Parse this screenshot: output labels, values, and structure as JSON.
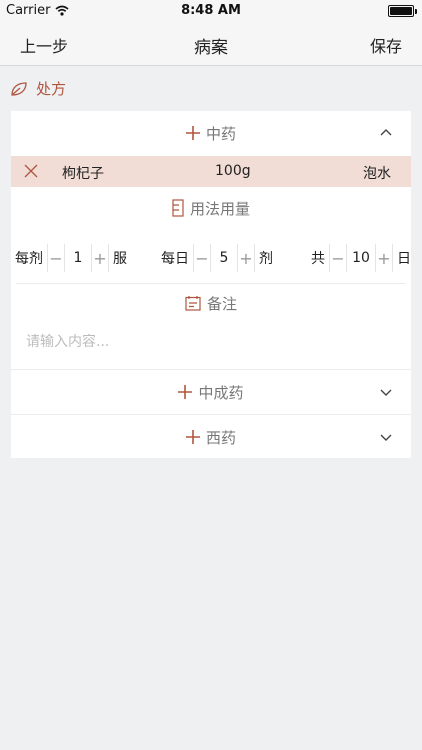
{
  "status_bar": {
    "carrier": "Carrier",
    "time": "8:48 AM"
  },
  "nav": {
    "back": "上一步",
    "title": "病案",
    "save": "保存"
  },
  "section": {
    "label": "处方"
  },
  "chinese_herbs": {
    "label": "中药",
    "items": [
      {
        "name": "枸杞子",
        "dose": "100g",
        "method": "泡水"
      }
    ]
  },
  "usage": {
    "label": "用法用量",
    "per_dose": {
      "label": "每剂",
      "value": "1",
      "unit": "服"
    },
    "per_day": {
      "label": "每日",
      "value": "5",
      "unit": "剂"
    },
    "total": {
      "label": "共",
      "value": "10",
      "unit": "日"
    }
  },
  "note": {
    "label": "备注",
    "placeholder": "请输入内容..."
  },
  "patent_medicine": {
    "label": "中成药"
  },
  "western_medicine": {
    "label": "西药"
  },
  "colors": {
    "accent": "#b0553f",
    "highlight_row": "#f1ddd6",
    "background": "#eff0f2"
  }
}
